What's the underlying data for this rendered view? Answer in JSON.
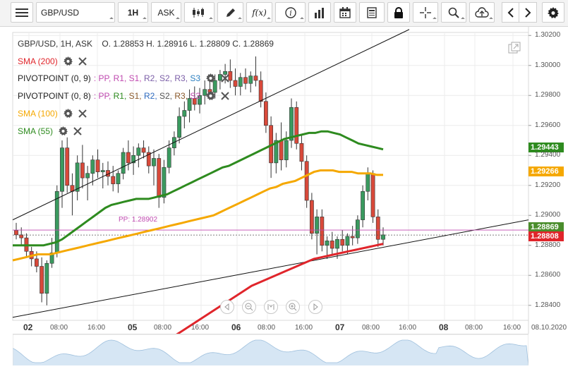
{
  "toolbar": {
    "symbol": "GBP/USD",
    "timeframe": "1H",
    "price_type": "ASK",
    "fx_label": "f(x)"
  },
  "header": {
    "instrument_line": "GBP/USD, 1H, ASK",
    "ohlc": "O. 1.28853 H. 1.28916 L. 1.28809 C. 1.28869"
  },
  "indicators": [
    {
      "label": "SMA (200)",
      "color": "#e0252b"
    },
    {
      "label": "PIVOTPOINT (0, 9)",
      "color": "#222222",
      "levels_label": ": PP, R1, S1, R2, S2, R3, S3"
    },
    {
      "label": "PIVOTPOINT (0, 8)",
      "color": "#222222",
      "levels_label": ": PP, R1, S1, R2, S2, R3, S3"
    },
    {
      "label": "SMA (100)",
      "color": "#f5a800"
    },
    {
      "label": "SMA (55)",
      "color": "#2e8b1f"
    }
  ],
  "pivot_line_label": "PP: 1.28902",
  "price_axis": [
    "1.30200",
    "1.30000",
    "1.29800",
    "1.29600",
    "1.29400",
    "1.29200",
    "1.29000",
    "1.28800",
    "1.28600",
    "1.28400"
  ],
  "price_tags": {
    "sma55": {
      "value": "1.29443",
      "color": "#2e8b1f"
    },
    "sma100": {
      "value": "1.29266",
      "color": "#f5a800"
    },
    "current": {
      "value": "1.28869",
      "color": "#4a8d2c"
    },
    "sma200": {
      "value": "1.28808",
      "color": "#e0252b"
    }
  },
  "time_axis": [
    {
      "label": "02",
      "day": true
    },
    {
      "label": "08:00",
      "day": false
    },
    {
      "label": "16:00",
      "day": false
    },
    {
      "label": "05",
      "day": true
    },
    {
      "label": "08:00",
      "day": false
    },
    {
      "label": "16:00",
      "day": false
    },
    {
      "label": "06",
      "day": true
    },
    {
      "label": "08:00",
      "day": false
    },
    {
      "label": "16:00",
      "day": false
    },
    {
      "label": "07",
      "day": true
    },
    {
      "label": "08:00",
      "day": false
    },
    {
      "label": "16:00",
      "day": false
    },
    {
      "label": "08",
      "day": true
    },
    {
      "label": "08:00",
      "day": false
    },
    {
      "label": "16:00",
      "day": false
    },
    {
      "label": "08.10.2020",
      "day": false
    }
  ],
  "icons": [
    "menu-icon",
    "candles-icon",
    "pencil-icon",
    "fx-icon",
    "info-icon",
    "bars-icon",
    "calendar-icon",
    "document-icon",
    "lock-icon",
    "crosshair-icon",
    "zoom-icon",
    "cloud-upload-icon",
    "arrow-left-icon",
    "arrow-right-icon",
    "gear-icon",
    "settings-icon",
    "close-icon",
    "expand-icon"
  ],
  "chart_data": {
    "type": "candlestick",
    "title": "",
    "xlabel": "",
    "ylabel": "",
    "ylim": [
      1.283,
      1.3022
    ],
    "candles": [
      [
        1.289,
        1.2895,
        1.2884,
        1.2887
      ],
      [
        1.2887,
        1.2892,
        1.288,
        1.2885
      ],
      [
        1.2885,
        1.2888,
        1.2872,
        1.2876
      ],
      [
        1.2876,
        1.2879,
        1.2866,
        1.2871
      ],
      [
        1.2871,
        1.2876,
        1.2862,
        1.2866
      ],
      [
        1.2866,
        1.2872,
        1.2842,
        1.2848
      ],
      [
        1.2848,
        1.287,
        1.284,
        1.2868
      ],
      [
        1.2868,
        1.2885,
        1.2865,
        1.2875
      ],
      [
        1.2875,
        1.292,
        1.2872,
        1.2916
      ],
      [
        1.2916,
        1.295,
        1.2905,
        1.2945
      ],
      [
        1.2945,
        1.2952,
        1.2915,
        1.292
      ],
      [
        1.292,
        1.2928,
        1.29,
        1.2916
      ],
      [
        1.2916,
        1.294,
        1.291,
        1.2935
      ],
      [
        1.2935,
        1.2947,
        1.2918,
        1.2925
      ],
      [
        1.2925,
        1.2933,
        1.291,
        1.2928
      ],
      [
        1.2928,
        1.294,
        1.292,
        1.2937
      ],
      [
        1.2937,
        1.2944,
        1.2925,
        1.2929
      ],
      [
        1.2929,
        1.2935,
        1.2918,
        1.293
      ],
      [
        1.293,
        1.2936,
        1.292,
        1.2926
      ],
      [
        1.2926,
        1.2933,
        1.2916,
        1.2921
      ],
      [
        1.2921,
        1.293,
        1.2915,
        1.2928
      ],
      [
        1.2928,
        1.2945,
        1.2924,
        1.2942
      ],
      [
        1.2942,
        1.295,
        1.293,
        1.2935
      ],
      [
        1.2935,
        1.2946,
        1.2927,
        1.294
      ],
      [
        1.294,
        1.2948,
        1.2932,
        1.2945
      ],
      [
        1.2945,
        1.295,
        1.2938,
        1.2942
      ],
      [
        1.2942,
        1.2946,
        1.2928,
        1.2933
      ],
      [
        1.2933,
        1.2944,
        1.292,
        1.2938
      ],
      [
        1.2938,
        1.2941,
        1.2905,
        1.2912
      ],
      [
        1.2912,
        1.2937,
        1.2908,
        1.2932
      ],
      [
        1.2932,
        1.295,
        1.2928,
        1.2945
      ],
      [
        1.2945,
        1.2956,
        1.294,
        1.2952
      ],
      [
        1.2952,
        1.2972,
        1.2948,
        1.2966
      ],
      [
        1.2966,
        1.2976,
        1.2958,
        1.297
      ],
      [
        1.297,
        1.2984,
        1.2962,
        1.2978
      ],
      [
        1.2978,
        1.2986,
        1.297,
        1.2974
      ],
      [
        1.2974,
        1.2985,
        1.2968,
        1.298
      ],
      [
        1.298,
        1.299,
        1.2974,
        1.2984
      ],
      [
        1.2984,
        1.2992,
        1.2977,
        1.2982
      ],
      [
        1.2982,
        1.2994,
        1.2978,
        1.299
      ],
      [
        1.299,
        1.2997,
        1.2984,
        1.2994
      ],
      [
        1.2994,
        1.3001,
        1.2988,
        1.2996
      ],
      [
        1.2996,
        1.3004,
        1.2985,
        1.299
      ],
      [
        1.299,
        1.2998,
        1.298,
        1.2986
      ],
      [
        1.2986,
        1.2995,
        1.298,
        1.2992
      ],
      [
        1.2992,
        1.2998,
        1.2984,
        1.2988
      ],
      [
        1.2988,
        1.2996,
        1.2982,
        1.2993
      ],
      [
        1.2993,
        1.3006,
        1.2986,
        1.299
      ],
      [
        1.299,
        1.2996,
        1.2972,
        1.2976
      ],
      [
        1.2976,
        1.2982,
        1.2955,
        1.296
      ],
      [
        1.296,
        1.2966,
        1.2925,
        1.2935
      ],
      [
        1.2935,
        1.2955,
        1.2928,
        1.295
      ],
      [
        1.295,
        1.2962,
        1.293,
        1.2937
      ],
      [
        1.2937,
        1.2956,
        1.2932,
        1.295
      ],
      [
        1.295,
        1.2978,
        1.2945,
        1.2972
      ],
      [
        1.2972,
        1.2976,
        1.2944,
        1.2948
      ],
      [
        1.2948,
        1.2954,
        1.293,
        1.2936
      ],
      [
        1.2936,
        1.294,
        1.2905,
        1.291
      ],
      [
        1.291,
        1.2915,
        1.2884,
        1.2888
      ],
      [
        1.2888,
        1.2904,
        1.2874,
        1.2899
      ],
      [
        1.2899,
        1.2904,
        1.2876,
        1.288
      ],
      [
        1.288,
        1.2886,
        1.2871,
        1.2883
      ],
      [
        1.2883,
        1.2889,
        1.2873,
        1.2878
      ],
      [
        1.2878,
        1.2886,
        1.2871,
        1.2884
      ],
      [
        1.2884,
        1.289,
        1.2876,
        1.288
      ],
      [
        1.288,
        1.2888,
        1.2874,
        1.2886
      ],
      [
        1.2886,
        1.2893,
        1.288,
        1.2885
      ],
      [
        1.2885,
        1.29,
        1.2881,
        1.2897
      ],
      [
        1.2897,
        1.292,
        1.2892,
        1.2916
      ],
      [
        1.2916,
        1.2932,
        1.291,
        1.2928
      ],
      [
        1.2928,
        1.293,
        1.2895,
        1.2899
      ],
      [
        1.2899,
        1.2904,
        1.2879,
        1.2884
      ],
      [
        1.2884,
        1.2892,
        1.288,
        1.2887
      ]
    ],
    "sma55": [
      1.288,
      1.288,
      1.288,
      1.288,
      1.288,
      1.288,
      1.2881,
      1.2882,
      1.2884,
      1.2887,
      1.289,
      1.2893,
      1.2896,
      1.2899,
      1.2902,
      1.2905,
      1.2907,
      1.2908,
      1.2909,
      1.291,
      1.2911,
      1.2911,
      1.2911,
      1.2912,
      1.2913,
      1.2914,
      1.2916,
      1.2918,
      1.292,
      1.2922,
      1.2924,
      1.2926,
      1.2928,
      1.293,
      1.2932,
      1.2933,
      1.2935,
      1.2937,
      1.2939,
      1.2941,
      1.2943,
      1.2945,
      1.2947,
      1.2949,
      1.2951,
      1.2952,
      1.2953,
      1.2954,
      1.2955,
      1.2955,
      1.2956,
      1.2956,
      1.2955,
      1.2954,
      1.2952,
      1.295,
      1.2948,
      1.2947,
      1.2946,
      1.2945,
      1.2944
    ],
    "sma100": [
      1.287,
      1.2871,
      1.2872,
      1.2873,
      1.2874,
      1.2874,
      1.2874,
      1.2875,
      1.2876,
      1.2877,
      1.2878,
      1.2879,
      1.288,
      1.2881,
      1.2882,
      1.2883,
      1.2884,
      1.2885,
      1.2886,
      1.2887,
      1.2888,
      1.2889,
      1.289,
      1.2891,
      1.2892,
      1.2893,
      1.2894,
      1.2895,
      1.2896,
      1.2897,
      1.2898,
      1.2899,
      1.29,
      1.2902,
      1.2904,
      1.2906,
      1.2908,
      1.291,
      1.2912,
      1.2914,
      1.2916,
      1.2918,
      1.2919,
      1.2921,
      1.2922,
      1.2923,
      1.2925,
      1.2927,
      1.2929,
      1.293,
      1.293,
      1.293,
      1.2929,
      1.2929,
      1.2929,
      1.2928,
      1.2928,
      1.2928,
      1.2927,
      1.2927
    ],
    "sma200": [
      1.2799,
      1.2802,
      1.2805,
      1.2808,
      1.2811,
      1.2814,
      1.2817,
      1.282,
      1.2823,
      1.2826,
      1.2829,
      1.2832,
      1.2835,
      1.2838,
      1.2841,
      1.2844,
      1.2847,
      1.285,
      1.2853,
      1.2855,
      1.2857,
      1.2859,
      1.2861,
      1.2863,
      1.2865,
      1.2867,
      1.2869,
      1.2871,
      1.2872,
      1.2873,
      1.2874,
      1.2875,
      1.2876,
      1.2877,
      1.2878,
      1.2879,
      1.288,
      1.2881
    ]
  }
}
